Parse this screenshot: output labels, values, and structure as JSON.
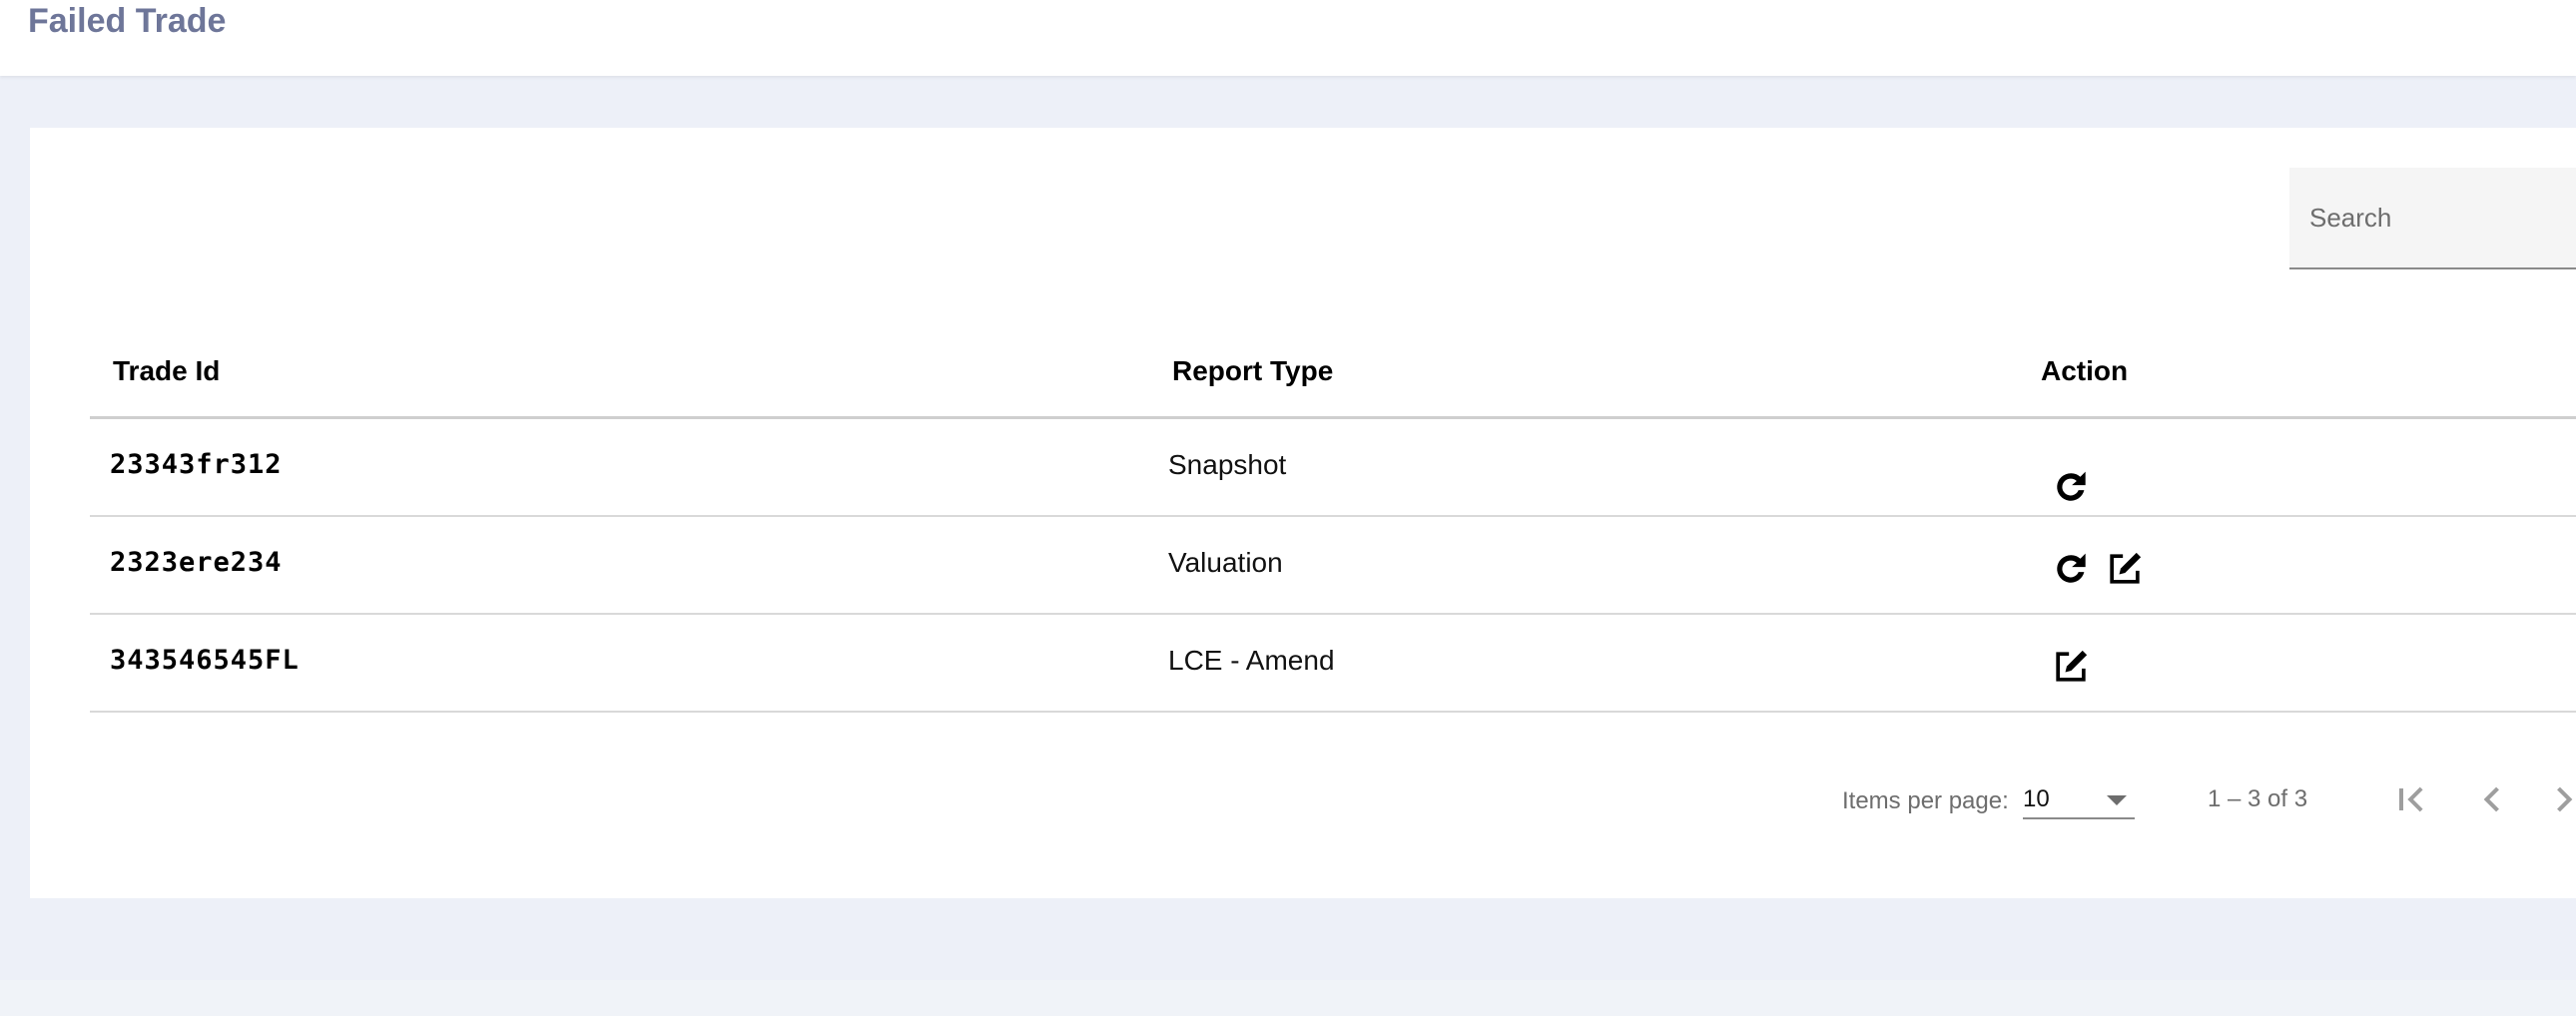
{
  "header": {
    "title": "Failed Trade"
  },
  "search": {
    "placeholder": "Search"
  },
  "table": {
    "columns": [
      "Trade Id",
      "Report Type",
      "Action"
    ],
    "rows": [
      {
        "trade_id": "23343fr312",
        "report_type": "Snapshot",
        "actions": [
          "refresh-icon"
        ]
      },
      {
        "trade_id": "2323ere234",
        "report_type": "Valuation",
        "actions": [
          "refresh-icon",
          "edit-icon"
        ]
      },
      {
        "trade_id": "343546545FL",
        "report_type": "LCE - Amend",
        "actions": [
          "edit-icon"
        ]
      }
    ]
  },
  "paginator": {
    "items_per_page_label": "Items per page:",
    "page_size": "10",
    "range_label": "1 – 3 of 3",
    "icons": [
      "first-page-icon",
      "previous-page-icon",
      "next-page-icon"
    ]
  },
  "colors": {
    "title": "#6e7699",
    "background": "#edf0f8",
    "card": "#ffffff"
  }
}
